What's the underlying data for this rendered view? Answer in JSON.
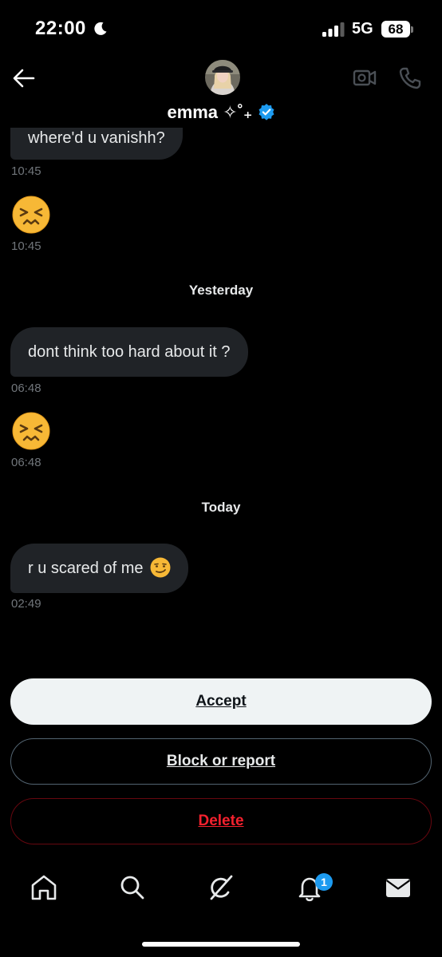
{
  "status_bar": {
    "time": "22:00",
    "network": "5G",
    "battery": "68",
    "icons": [
      "moon-icon",
      "signal-icon"
    ]
  },
  "header": {
    "display_name": "emma ✧˚₊",
    "verified": true,
    "icons": [
      "back-arrow-icon",
      "video-call-icon",
      "phone-icon"
    ]
  },
  "messages": [
    {
      "text": "where'd u vanishh?",
      "time": "10:45"
    },
    {
      "emoji": "confounded-face",
      "time": "10:45"
    },
    {
      "day_label": "Yesterday"
    },
    {
      "text": "dont think too hard about it ?",
      "time": "06:48"
    },
    {
      "emoji": "confounded-face",
      "time": "06:48"
    },
    {
      "day_label": "Today"
    },
    {
      "text": "r u scared of me",
      "emoji": "smirking-face",
      "time": "02:49"
    }
  ],
  "actions": {
    "accept": "Accept",
    "block_report": "Block or report",
    "delete": "Delete"
  },
  "nav": {
    "items": [
      "home-icon",
      "search-icon",
      "grok-icon",
      "notifications-icon",
      "messages-icon"
    ],
    "notifications_badge": "1"
  },
  "colors": {
    "background": "#000000",
    "bubble": "#202327",
    "accent_blue": "#1d9bf0",
    "danger_red": "#f4212e",
    "muted_text": "#71767b"
  }
}
